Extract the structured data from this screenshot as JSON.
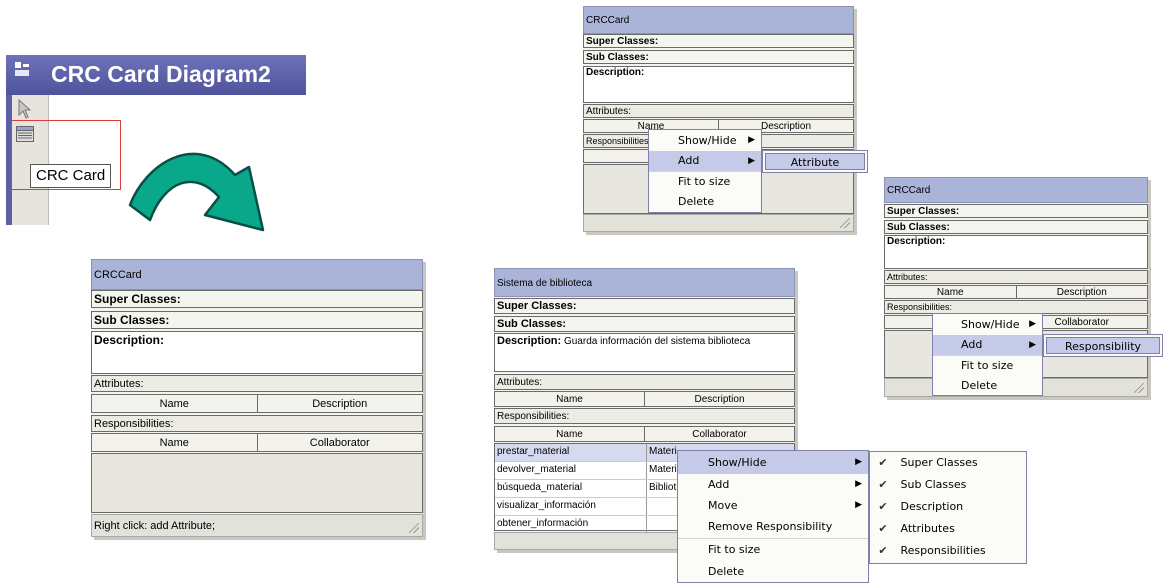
{
  "diagram": {
    "title": "CRC Card Diagram2",
    "palette": {
      "tooltip": "CRC Card"
    }
  },
  "card_main": {
    "name": "CRCCard",
    "super_classes": "Super Classes:",
    "sub_classes": "Sub Classes:",
    "description": "Description:",
    "attributes_label": "Attributes:",
    "attr_cols": [
      "Name",
      "Description"
    ],
    "responsibilities_label": "Responsibilities:",
    "resp_cols": [
      "Name",
      "Collaborator"
    ],
    "footer": "Right click: add Attribute;"
  },
  "card_top": {
    "name": "CRCCard",
    "super_classes": "Super Classes:",
    "sub_classes": "Sub Classes:",
    "description": "Description:",
    "attributes_label": "Attributes:",
    "attr_col_name": "Name",
    "attr_col_desc": "Description",
    "responsibilities_label": "Responsibilities:",
    "resp_col_name": "Na",
    "menu": {
      "show_hide": "Show/Hide",
      "add": "Add",
      "fit_to_size": "Fit to size",
      "delete": "Delete"
    },
    "submenu": {
      "attribute": "Attribute"
    }
  },
  "card_right": {
    "name": "CRCCard",
    "super_classes": "Super Classes:",
    "sub_classes": "Sub Classes:",
    "description": "Description:",
    "attributes_label": "Attributes:",
    "attr_cols": [
      "Name",
      "Description"
    ],
    "responsibilities_label": "Responsibilities:",
    "resp_col_collab": "Collaborator",
    "menu": {
      "show_hide": "Show/Hide",
      "add": "Add",
      "fit_to_size": "Fit to size",
      "delete": "Delete"
    },
    "submenu": {
      "responsibility": "Responsibility"
    }
  },
  "card_biblio": {
    "name": "Sistema de biblioteca",
    "super_classes": "Super Classes:",
    "sub_classes": "Sub Classes:",
    "description_label": "Description:",
    "description_text": "Guarda información del sistema biblioteca",
    "attributes_label": "Attributes:",
    "attr_cols": [
      "Name",
      "Description"
    ],
    "responsibilities_label": "Responsibilities:",
    "resp_cols": [
      "Name",
      "Collaborator"
    ],
    "responsibilities": [
      {
        "name": "prestar_material",
        "collab": "Materi"
      },
      {
        "name": "devolver_material",
        "collab": "Materi"
      },
      {
        "name": "búsqueda_material",
        "collab": "Bibliot"
      },
      {
        "name": "visualizar_información",
        "collab": ""
      },
      {
        "name": "obtener_información",
        "collab": ""
      }
    ],
    "menu": {
      "show_hide": "Show/Hide",
      "add": "Add",
      "move": "Move",
      "remove_responsibility": "Remove Responsibility",
      "fit_to_size": "Fit to size",
      "delete": "Delete"
    },
    "submenu": {
      "super_classes": "Super Classes",
      "sub_classes": "Sub Classes",
      "description": "Description",
      "attributes": "Attributes",
      "responsibilities": "Responsibilities"
    }
  },
  "colors": {
    "title_bar": "#5a5fa8",
    "card_header": "#a9b4d8",
    "menu_highlight": "#c5cae8",
    "arrow_fill": "#0aa88a",
    "highlight_box": "#e03a3a"
  }
}
